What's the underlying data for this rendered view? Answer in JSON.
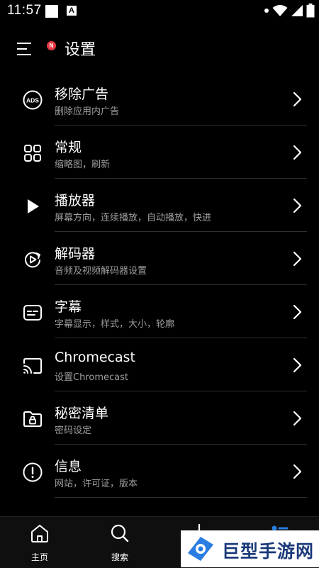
{
  "status_bar": {
    "time": "11:57",
    "notif_letter": "A"
  },
  "header": {
    "title": "设置",
    "badge": "N"
  },
  "settings": [
    {
      "title": "移除广告",
      "subtitle": "删除应用内广告",
      "icon": "ads-icon"
    },
    {
      "title": "常规",
      "subtitle": "缩略图，刷新",
      "icon": "grid-icon"
    },
    {
      "title": "播放器",
      "subtitle": "屏幕方向，连续播放，自动播放，快进",
      "icon": "play-icon"
    },
    {
      "title": "解码器",
      "subtitle": "音频及视频解码器设置",
      "icon": "decoder-icon"
    },
    {
      "title": "字幕",
      "subtitle": "字幕显示，样式，大小，轮廓",
      "icon": "subtitle-icon"
    },
    {
      "title": "Chromecast",
      "subtitle": "设置Chromecast",
      "icon": "cast-icon"
    },
    {
      "title": "秘密清单",
      "subtitle": "密码设定",
      "icon": "lock-folder-icon"
    },
    {
      "title": "信息",
      "subtitle": "网站，许可证，版本",
      "icon": "info-icon"
    }
  ],
  "bottom_nav": {
    "home": "主页",
    "search": "搜索"
  },
  "watermark": {
    "text": "巨型手游网"
  },
  "colors": {
    "background": "#000000",
    "subtitle": "#9e9e9e",
    "badge": "#e53945",
    "divider": "#2f2f2f",
    "watermark_text": "#1b3a7a",
    "watermark_accent": "#2a7de1"
  }
}
